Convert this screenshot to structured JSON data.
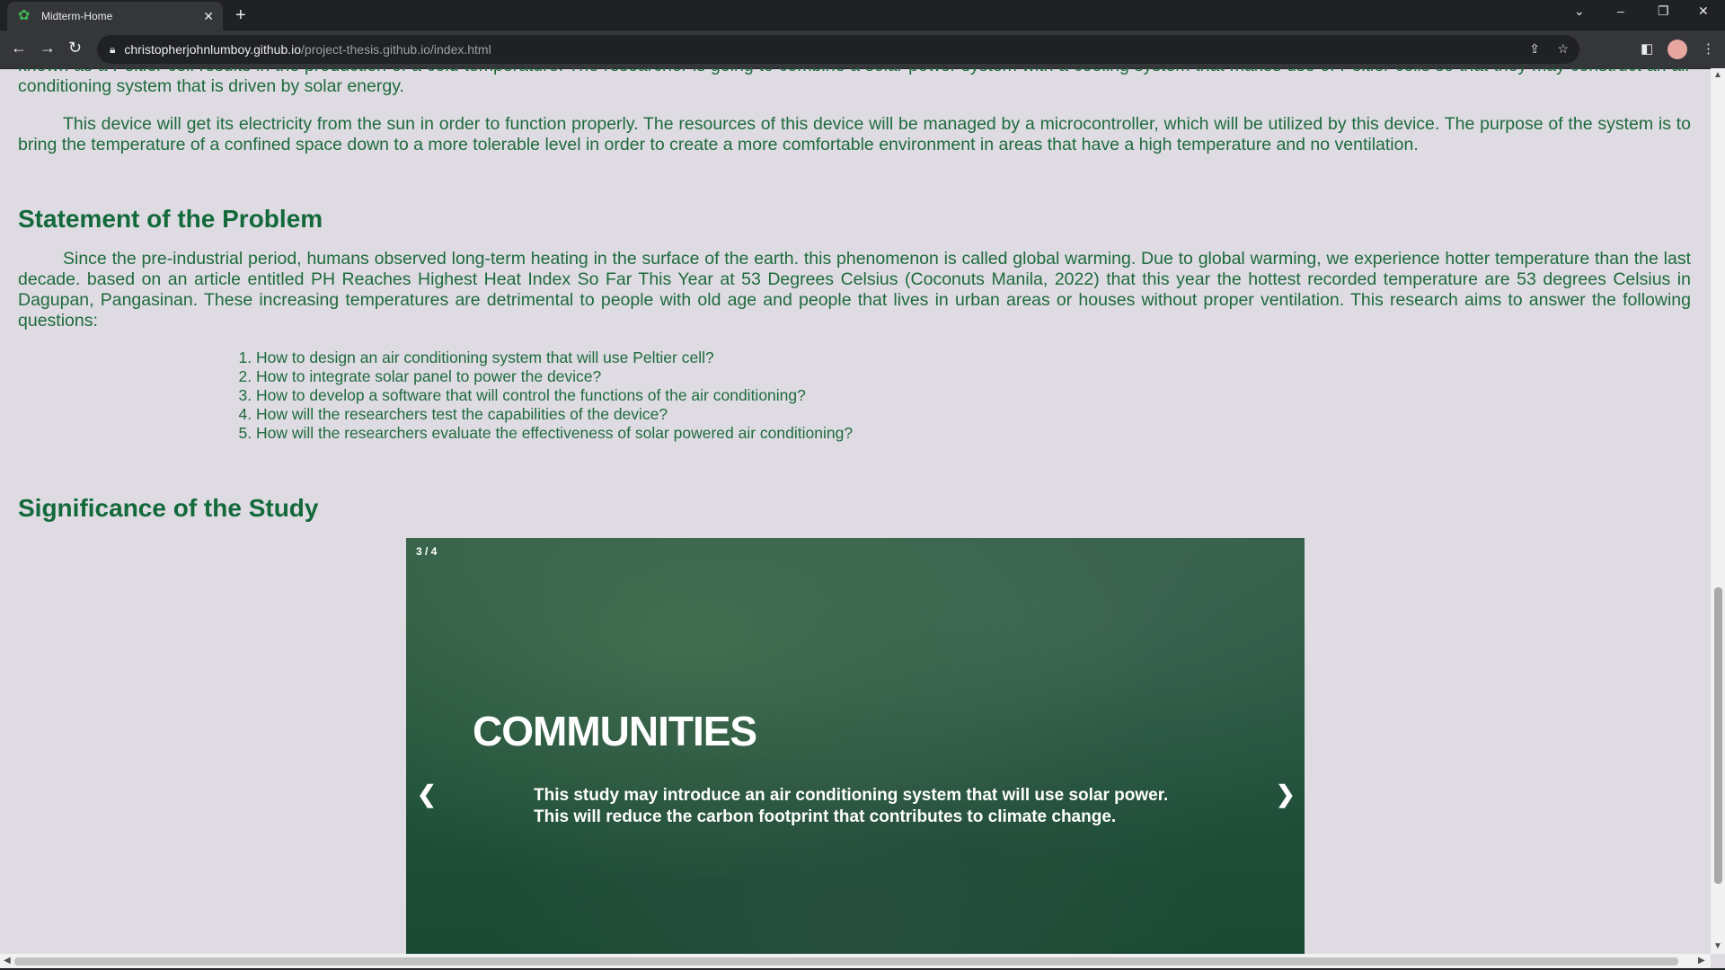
{
  "browser": {
    "tab_title": "Midterm-Home",
    "url_host": "christopherjohnlumboy.github.io",
    "url_path": "/project-thesis.github.io/index.html"
  },
  "content": {
    "intro_para_1": "known as a Peltier cell results in the production of a cold temperature. The researcher is going to combine a solar power system with a cooling system that makes use of Peltier cells so that they may construct an air conditioning system that is driven by solar energy.",
    "intro_para_2": "This device will get its electricity from the sun in order to function properly. The resources of this device will be managed by a microcontroller, which will be utilized by this device. The purpose of the system is to bring the temperature of a confined space down to a more tolerable level in order to create a more comfortable environment in areas that have a high temperature and no ventilation.",
    "problem_heading": "Statement of the Problem",
    "problem_para": "Since the pre-industrial period, humans observed long-term heating in the surface of the earth. this phenomenon is called global warming. Due to global warming, we experience hotter temperature than the last decade. based on an article entitled PH Reaches Highest Heat Index So Far This Year at 53 Degrees Celsius (Coconuts Manila, 2022) that this year the hottest recorded temperature are 53 degrees Celsius in Dagupan, Pangasinan. These increasing temperatures are detrimental to people with old age and people that lives in urban areas or houses without proper ventilation. This research aims to answer the following questions:",
    "questions": [
      "How to design an air conditioning system that will use Peltier cell?",
      "How to integrate solar panel to power the device?",
      "How to develop a software that will control the functions of the air conditioning?",
      "How will the researchers test the capabilities of the device?",
      "How will the researchers evaluate the effectiveness of solar powered air conditioning?"
    ],
    "significance_heading": "Significance of the Study"
  },
  "carousel": {
    "counter": "3 / 4",
    "heading": "COMMUNITIES",
    "caption_line1": "This study may introduce an air conditioning system that will use solar power.",
    "caption_line2": "This will reduce the carbon footprint that contributes to climate change.",
    "prev": "❮",
    "next": "❯"
  },
  "icons": {
    "tab_favicon": "clover-icon",
    "back": "back-arrow-icon",
    "forward": "forward-arrow-icon",
    "reload": "reload-icon"
  }
}
